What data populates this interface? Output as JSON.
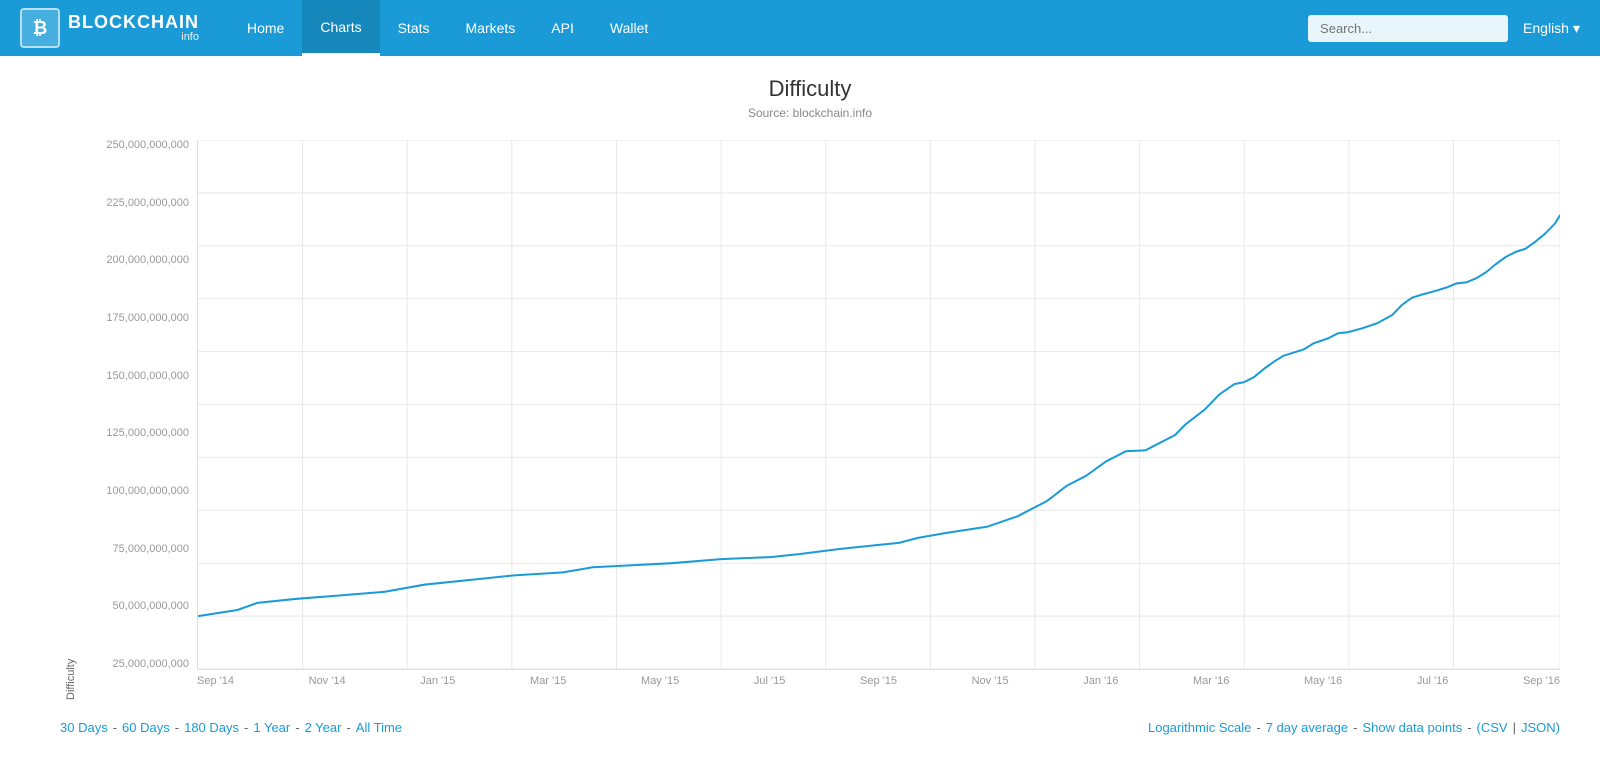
{
  "header": {
    "logo_main": "BLOCKCHAIN",
    "logo_sub": "info",
    "logo_icon": "₿",
    "nav_items": [
      {
        "label": "Home",
        "active": false
      },
      {
        "label": "Charts",
        "active": true
      },
      {
        "label": "Stats",
        "active": false
      },
      {
        "label": "Markets",
        "active": false
      },
      {
        "label": "API",
        "active": false
      },
      {
        "label": "Wallet",
        "active": false
      }
    ],
    "search_placeholder": "Search...",
    "language": "English",
    "lang_arrow": "▾"
  },
  "chart": {
    "title": "Difficulty",
    "source": "Source: blockchain.info",
    "y_axis_label": "Difficulty",
    "y_ticks": [
      "250,000,000,000",
      "225,000,000,000",
      "200,000,000,000",
      "175,000,000,000",
      "150,000,000,000",
      "125,000,000,000",
      "100,000,000,000",
      "75,000,000,000",
      "50,000,000,000",
      "25,000,000,000"
    ],
    "x_ticks": [
      "Sep '14",
      "Nov '14",
      "Jan '15",
      "Mar '15",
      "May '15",
      "Jul '15",
      "Sep '15",
      "Nov '15",
      "Jan '16",
      "Mar '16",
      "May '16",
      "Jul '16",
      "Sep '16"
    ]
  },
  "footer": {
    "left_links": [
      {
        "label": "30 Days",
        "sep": " - "
      },
      {
        "label": "60 Days",
        "sep": " - "
      },
      {
        "label": "180 Days",
        "sep": " - "
      },
      {
        "label": "1 Year",
        "sep": " - "
      },
      {
        "label": "2 Year",
        "sep": " - "
      },
      {
        "label": "All Time",
        "sep": ""
      }
    ],
    "right_links": [
      {
        "label": "Logarithmic Scale",
        "sep": " - "
      },
      {
        "label": "7 day average",
        "sep": " - "
      },
      {
        "label": "Show data points",
        "sep": " - "
      },
      {
        "label": "(CSV",
        "sep": " | "
      },
      {
        "label": "JSON)",
        "sep": ""
      }
    ]
  }
}
